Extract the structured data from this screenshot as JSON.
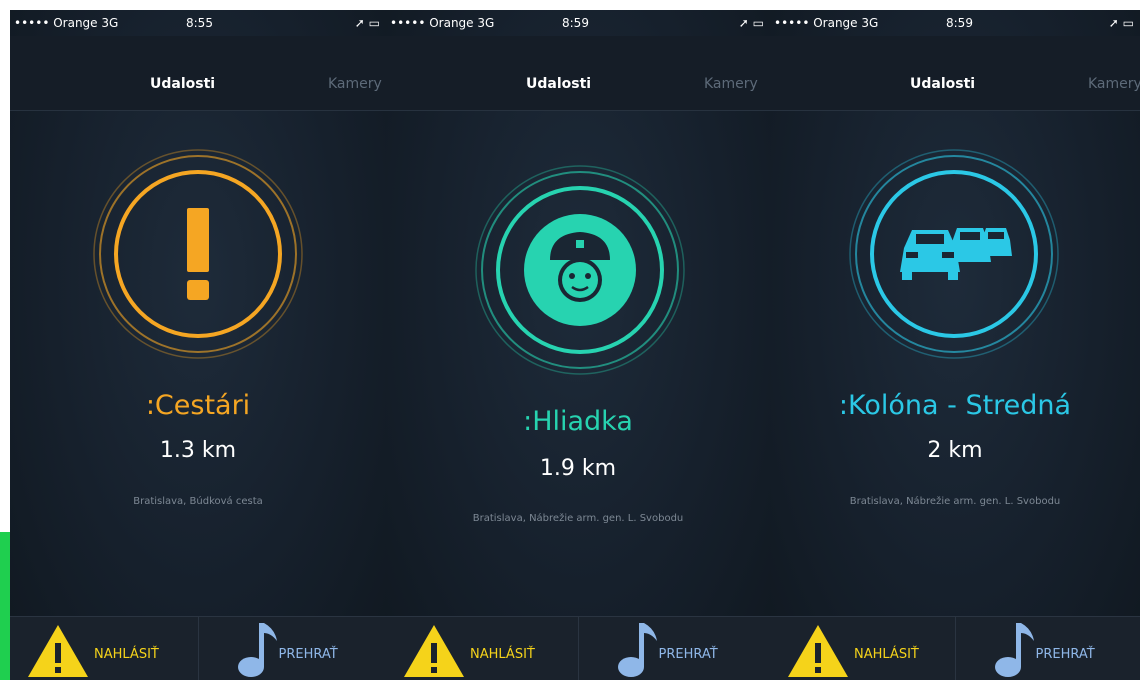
{
  "screens": [
    {
      "status": {
        "carrier": "••••• Orange  3G",
        "time": "8:55"
      },
      "nav": {
        "active_tab": "Udalosti",
        "next_tab": "Kamery"
      },
      "event": {
        "title": ":Cestári",
        "distance": "1.3 km",
        "address": "Bratislava, Búdková cesta",
        "color": "#f5a623",
        "icon": "exclamation-icon"
      },
      "actions": {
        "report_label": "NAHLÁSIŤ",
        "play_label": "PREHRAŤ"
      }
    },
    {
      "status": {
        "carrier": "••••• Orange  3G",
        "time": "8:59"
      },
      "nav": {
        "active_tab": "Udalosti",
        "next_tab": "Kamery"
      },
      "event": {
        "title": ":Hliadka",
        "distance": "1.9 km",
        "address": "Bratislava, Nábrežie arm. gen. L. Svobodu",
        "color": "#27d3b0",
        "icon": "police-officer-icon"
      },
      "actions": {
        "report_label": "NAHLÁSIŤ",
        "play_label": "PREHRAŤ"
      }
    },
    {
      "status": {
        "carrier": "••••• Orange  3G",
        "time": "8:59"
      },
      "nav": {
        "active_tab": "Udalosti",
        "next_tab": "Kamery"
      },
      "event": {
        "title": ":Kolóna - Stredná",
        "distance": "2 km",
        "address": "Bratislava, Nábrežie arm. gen. L. Svobodu",
        "color": "#2bc8e6",
        "icon": "traffic-jam-cars-icon"
      },
      "actions": {
        "report_label": "NAHLÁSIŤ",
        "play_label": "PREHRAŤ"
      }
    }
  ]
}
